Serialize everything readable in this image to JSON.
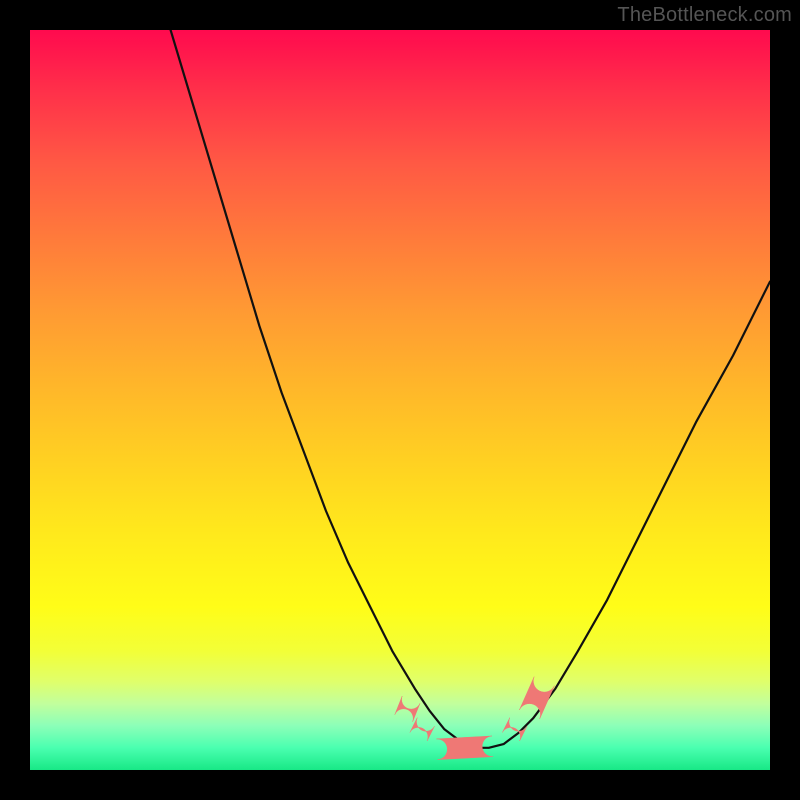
{
  "watermark": "TheBottleneck.com",
  "colors": {
    "frame": "#000000",
    "curve": "#111111",
    "marker_fill": "#ef7875",
    "marker_stroke": "#ef7875",
    "gradient_top": "#ff0a4e",
    "gradient_bottom": "#18e886"
  },
  "chart_data": {
    "type": "line",
    "title": "",
    "xlabel": "",
    "ylabel": "",
    "xlim": [
      0,
      100
    ],
    "ylim": [
      0,
      100
    ],
    "grid": false,
    "legend": false,
    "description": "V-shaped bottleneck curve over a vertical green-to-red gradient. Lower y = better (green). Curve minimum is a flat trough near x≈55–63 at y≈3. A cluster of pink rounded markers sits along the trough and slightly up the right side.",
    "series": [
      {
        "name": "bottleneck-curve",
        "x": [
          19,
          22,
          25,
          28,
          31,
          34,
          37,
          40,
          43,
          46,
          49,
          52,
          54,
          56,
          58,
          60,
          62,
          64,
          66,
          68,
          71,
          74,
          78,
          82,
          86,
          90,
          95,
          100
        ],
        "y": [
          100,
          90,
          80,
          70,
          60,
          51,
          43,
          35,
          28,
          22,
          16,
          11,
          8,
          5.5,
          4,
          3,
          3,
          3.5,
          5,
          7,
          11,
          16,
          23,
          31,
          39,
          47,
          56,
          66
        ]
      }
    ],
    "markers": [
      {
        "shape": "pill",
        "x0": 50.5,
        "y0": 7.0,
        "x1": 51.5,
        "y1": 9.5,
        "r": 1.3
      },
      {
        "shape": "pill",
        "x0": 52.5,
        "y0": 4.5,
        "x1": 53.5,
        "y1": 6.5,
        "r": 1.3
      },
      {
        "shape": "pill",
        "x0": 55.0,
        "y0": 2.8,
        "x1": 62.5,
        "y1": 3.2,
        "r": 1.4
      },
      {
        "shape": "pill",
        "x0": 65.0,
        "y0": 4.5,
        "x1": 66.0,
        "y1": 6.5,
        "r": 1.3
      },
      {
        "shape": "pill",
        "x0": 67.5,
        "y0": 7.5,
        "x1": 69.5,
        "y1": 12.0,
        "r": 1.5
      }
    ]
  }
}
